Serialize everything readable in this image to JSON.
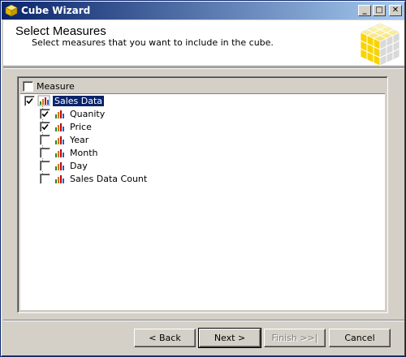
{
  "window": {
    "title": "Cube Wizard"
  },
  "titlebar_buttons": {
    "minimize": "_",
    "maximize": "□",
    "close": "✕"
  },
  "header": {
    "title": "Select Measures",
    "subtitle": "Select measures that you want to include in the cube."
  },
  "tree": {
    "column_header": "Measure",
    "column_checked": false,
    "group": {
      "label": "Sales Data",
      "checked": true,
      "selected": true
    },
    "items": [
      {
        "label": "Quanity",
        "checked": true
      },
      {
        "label": "Price",
        "checked": true
      },
      {
        "label": "Year",
        "checked": false
      },
      {
        "label": "Month",
        "checked": false
      },
      {
        "label": "Day",
        "checked": false
      },
      {
        "label": "Sales Data Count",
        "checked": false
      }
    ]
  },
  "buttons": {
    "back": "< Back",
    "next": "Next >",
    "finish": "Finish >>|",
    "cancel": "Cancel"
  },
  "colors": {
    "titlebar": "#0a246a",
    "selection": "#0a246a",
    "face": "#d4d0c8",
    "cube": "#f5d000"
  }
}
